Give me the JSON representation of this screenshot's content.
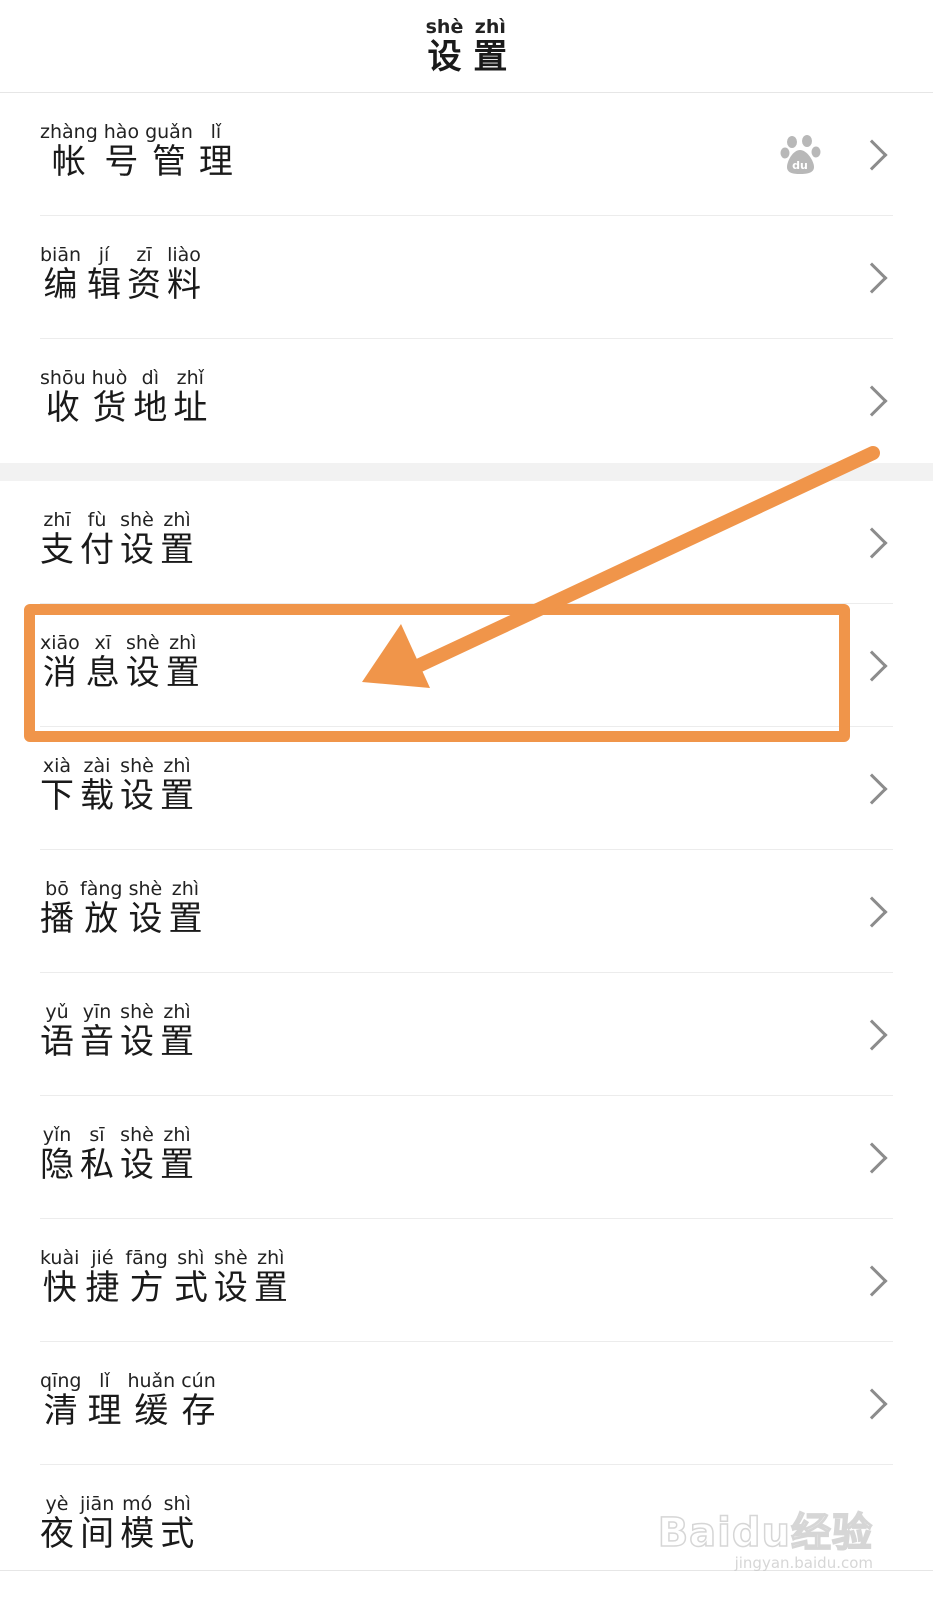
{
  "header": {
    "title": [
      {
        "py": "shè",
        "hz": "设"
      },
      {
        "py": "zhì",
        "hz": "置"
      }
    ]
  },
  "rows": [
    {
      "chars": [
        {
          "py": "zhàng",
          "hz": "帐"
        },
        {
          "py": "hào",
          "hz": "号"
        },
        {
          "py": "guǎn",
          "hz": "管"
        },
        {
          "py": "lǐ",
          "hz": "理"
        }
      ],
      "icon": "baidu-paw-icon"
    },
    {
      "chars": [
        {
          "py": "biān",
          "hz": "编"
        },
        {
          "py": "jí",
          "hz": "辑"
        },
        {
          "py": "zī",
          "hz": "资"
        },
        {
          "py": "liào",
          "hz": "料"
        }
      ]
    },
    {
      "chars": [
        {
          "py": "shōu",
          "hz": "收"
        },
        {
          "py": "huò",
          "hz": "货"
        },
        {
          "py": "dì",
          "hz": "地"
        },
        {
          "py": "zhǐ",
          "hz": "址"
        }
      ]
    },
    {
      "chars": [
        {
          "py": "zhī",
          "hz": "支"
        },
        {
          "py": "fù",
          "hz": "付"
        },
        {
          "py": "shè",
          "hz": "设"
        },
        {
          "py": "zhì",
          "hz": "置"
        }
      ]
    },
    {
      "chars": [
        {
          "py": "xiāo",
          "hz": "消"
        },
        {
          "py": "xī",
          "hz": "息"
        },
        {
          "py": "shè",
          "hz": "设"
        },
        {
          "py": "zhì",
          "hz": "置"
        }
      ],
      "highlighted": true
    },
    {
      "chars": [
        {
          "py": "xià",
          "hz": "下"
        },
        {
          "py": "zài",
          "hz": "载"
        },
        {
          "py": "shè",
          "hz": "设"
        },
        {
          "py": "zhì",
          "hz": "置"
        }
      ]
    },
    {
      "chars": [
        {
          "py": "bō",
          "hz": "播"
        },
        {
          "py": "fàng",
          "hz": "放"
        },
        {
          "py": "shè",
          "hz": "设"
        },
        {
          "py": "zhì",
          "hz": "置"
        }
      ]
    },
    {
      "chars": [
        {
          "py": "yǔ",
          "hz": "语"
        },
        {
          "py": "yīn",
          "hz": "音"
        },
        {
          "py": "shè",
          "hz": "设"
        },
        {
          "py": "zhì",
          "hz": "置"
        }
      ]
    },
    {
      "chars": [
        {
          "py": "yǐn",
          "hz": "隐"
        },
        {
          "py": "sī",
          "hz": "私"
        },
        {
          "py": "shè",
          "hz": "设"
        },
        {
          "py": "zhì",
          "hz": "置"
        }
      ]
    },
    {
      "chars": [
        {
          "py": "kuài",
          "hz": "快"
        },
        {
          "py": "jié",
          "hz": "捷"
        },
        {
          "py": "fāng",
          "hz": "方"
        },
        {
          "py": "shì",
          "hz": "式"
        },
        {
          "py": "shè",
          "hz": "设"
        },
        {
          "py": "zhì",
          "hz": "置"
        }
      ]
    },
    {
      "chars": [
        {
          "py": "qīng",
          "hz": "清"
        },
        {
          "py": "lǐ",
          "hz": "理"
        },
        {
          "py": "huǎn",
          "hz": "缓"
        },
        {
          "py": "cún",
          "hz": "存"
        }
      ]
    },
    {
      "chars": [
        {
          "py": "yè",
          "hz": "夜"
        },
        {
          "py": "jiān",
          "hz": "间"
        },
        {
          "py": "mó",
          "hz": "模"
        },
        {
          "py": "shì",
          "hz": "式"
        }
      ],
      "toggle": true
    }
  ],
  "annotation": {
    "color": "#f0954a"
  },
  "watermark": {
    "main": "Baidu经验",
    "sub": "jingyan.baidu.com"
  }
}
